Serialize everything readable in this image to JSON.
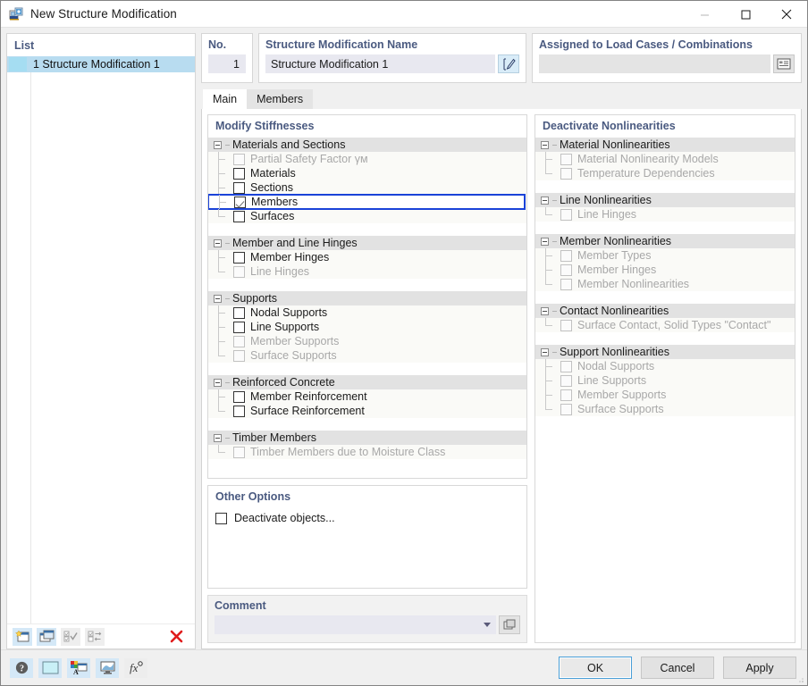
{
  "window": {
    "title": "New Structure Modification",
    "icon": "structure-modification-icon",
    "minimize": "—",
    "maximize": "□",
    "close": "✕"
  },
  "list_panel": {
    "header": "List",
    "rows": [
      {
        "number": "1",
        "label": "1 Structure Modification 1",
        "selected": true
      }
    ],
    "toolbar": [
      {
        "name": "new-item-icon",
        "state": "active"
      },
      {
        "name": "copy-item-icon",
        "state": "active"
      },
      {
        "name": "select-all-icon",
        "state": "disabled"
      },
      {
        "name": "invert-selection-icon",
        "state": "disabled"
      },
      {
        "name": "delete-item-icon",
        "state": "enabled",
        "glyph": "✕"
      }
    ]
  },
  "header": {
    "no_label": "No.",
    "no_value": "1",
    "name_label": "Structure Modification Name",
    "name_value": "Structure Modification 1",
    "name_edit_icon": "rename-icon",
    "assigned_label": "Assigned to Load Cases / Combinations",
    "assigned_value": "",
    "assigned_picker_icon": "load-case-picker-icon"
  },
  "tabs": [
    {
      "label": "Main",
      "active": true
    },
    {
      "label": "Members",
      "active": false
    }
  ],
  "modify_stiffnesses": {
    "title": "Modify Stiffnesses",
    "groups": [
      {
        "label": "Materials and Sections",
        "items": [
          {
            "label": "Partial Safety Factor γᴍ",
            "checked": false,
            "disabled": true
          },
          {
            "label": "Materials",
            "checked": false,
            "disabled": false
          },
          {
            "label": "Sections",
            "checked": false,
            "disabled": false
          },
          {
            "label": "Members",
            "checked": true,
            "disabled": false,
            "focused": true
          },
          {
            "label": "Surfaces",
            "checked": false,
            "disabled": false
          }
        ]
      },
      {
        "label": "Member and Line Hinges",
        "items": [
          {
            "label": "Member Hinges",
            "checked": false,
            "disabled": false
          },
          {
            "label": "Line Hinges",
            "checked": false,
            "disabled": true
          }
        ]
      },
      {
        "label": "Supports",
        "items": [
          {
            "label": "Nodal Supports",
            "checked": false,
            "disabled": false
          },
          {
            "label": "Line Supports",
            "checked": false,
            "disabled": false
          },
          {
            "label": "Member Supports",
            "checked": false,
            "disabled": true
          },
          {
            "label": "Surface Supports",
            "checked": false,
            "disabled": true
          }
        ]
      },
      {
        "label": "Reinforced Concrete",
        "items": [
          {
            "label": "Member Reinforcement",
            "checked": false,
            "disabled": false
          },
          {
            "label": "Surface Reinforcement",
            "checked": false,
            "disabled": false
          }
        ]
      },
      {
        "label": "Timber Members",
        "items": [
          {
            "label": "Timber Members due to Moisture Class",
            "checked": false,
            "disabled": true
          }
        ]
      }
    ]
  },
  "deactivate_nonlinearities": {
    "title": "Deactivate Nonlinearities",
    "groups": [
      {
        "label": "Material Nonlinearities",
        "items": [
          {
            "label": "Material Nonlinearity Models",
            "checked": false,
            "disabled": true
          },
          {
            "label": "Temperature Dependencies",
            "checked": false,
            "disabled": true
          }
        ]
      },
      {
        "label": "Line Nonlinearities",
        "items": [
          {
            "label": "Line Hinges",
            "checked": false,
            "disabled": true
          }
        ]
      },
      {
        "label": "Member Nonlinearities",
        "items": [
          {
            "label": "Member Types",
            "checked": false,
            "disabled": true
          },
          {
            "label": "Member Hinges",
            "checked": false,
            "disabled": true
          },
          {
            "label": "Member Nonlinearities",
            "checked": false,
            "disabled": true
          }
        ]
      },
      {
        "label": "Contact Nonlinearities",
        "items": [
          {
            "label": "Surface Contact, Solid Types \"Contact\"",
            "checked": false,
            "disabled": true
          }
        ]
      },
      {
        "label": "Support Nonlinearities",
        "items": [
          {
            "label": "Nodal Supports",
            "checked": false,
            "disabled": true
          },
          {
            "label": "Line Supports",
            "checked": false,
            "disabled": true
          },
          {
            "label": "Member Supports",
            "checked": false,
            "disabled": true
          },
          {
            "label": "Surface Supports",
            "checked": false,
            "disabled": true
          }
        ]
      }
    ]
  },
  "other_options": {
    "title": "Other Options",
    "items": [
      {
        "label": "Deactivate objects...",
        "checked": false
      }
    ]
  },
  "comment": {
    "title": "Comment",
    "value": "",
    "picker_icon": "comment-library-icon"
  },
  "footer": {
    "icons": [
      {
        "name": "help-icon",
        "state": "active"
      },
      {
        "name": "color-swatch-icon",
        "state": "active"
      },
      {
        "name": "display-properties-icon",
        "state": "active"
      },
      {
        "name": "render-view-icon",
        "state": "active"
      },
      {
        "name": "formula-icon",
        "state": "plain"
      }
    ],
    "buttons": [
      {
        "label": "OK",
        "default": true
      },
      {
        "label": "Cancel",
        "default": false
      },
      {
        "label": "Apply",
        "default": false
      }
    ]
  },
  "colors": {
    "accent_heading": "#4a5a80",
    "focus_outline": "#1a42d8",
    "selection": "#b8dcf0",
    "group_header": "#e2e2e2",
    "row_tint": "#fafaf7",
    "field": "#e8e8f0",
    "delete_red": "#e01b1b"
  }
}
